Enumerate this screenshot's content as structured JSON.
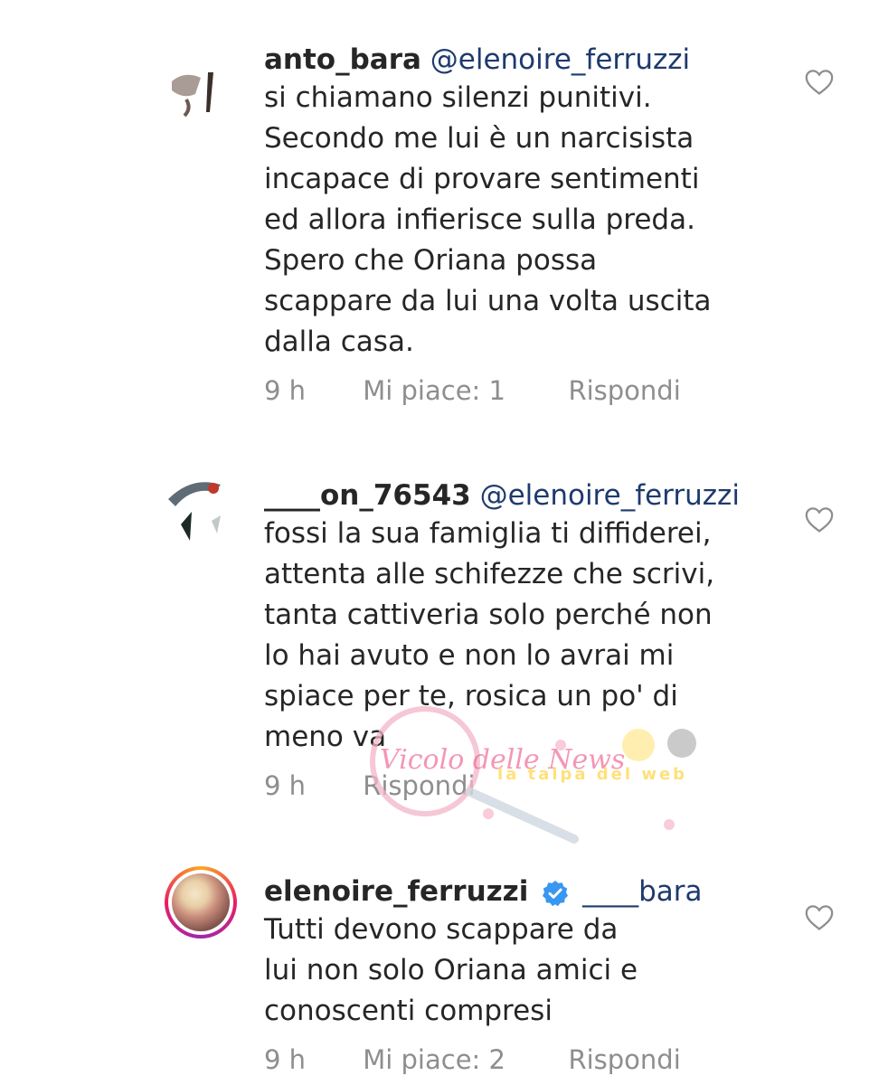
{
  "comments": [
    {
      "username": "anto_bara",
      "mention": "@elenoire_ferruzzi",
      "lines": [
        "si chiamano silenzi punitivi.",
        "Secondo me lui è un narcisista",
        "incapace di provare sentimenti",
        "ed allora infierisce sulla preda.",
        "Spero che Oriana possa",
        "scappare da lui una volta uscita",
        "dalla casa."
      ],
      "time": "9 h",
      "likes": "Mi piace: 1",
      "reply": "Rispondi"
    },
    {
      "username": "____on_76543",
      "mention": "@elenoire_ferruzzi",
      "lines": [
        "fossi la sua famiglia ti diffiderei,",
        "attenta alle schifezze che scrivi,",
        "tanta cattiveria solo perché non",
        "lo hai avuto e non lo avrai mi",
        "spiace per te, rosica un po' di",
        "meno va"
      ],
      "time": "9 h",
      "likes": "",
      "reply": "Rispondi"
    },
    {
      "username": "elenoire_ferruzzi",
      "mention": "____bara",
      "verified": true,
      "lines": [
        "Tutti devono scappare da",
        "lui non solo Oriana amici e",
        "conoscenti compresi"
      ],
      "time": "9 h",
      "likes": "Mi piace: 2",
      "reply": "Rispondi"
    }
  ],
  "icons": {
    "heart": "heart-outline-icon",
    "verified": "verified-badge-icon"
  },
  "colors": {
    "text": "#262626",
    "meta": "#8e8e8e",
    "mention": "#1e3a6e",
    "verified": "#3897f0"
  },
  "watermark": {
    "text1": "Vicolo delle News",
    "text2": "la talpa del web"
  }
}
